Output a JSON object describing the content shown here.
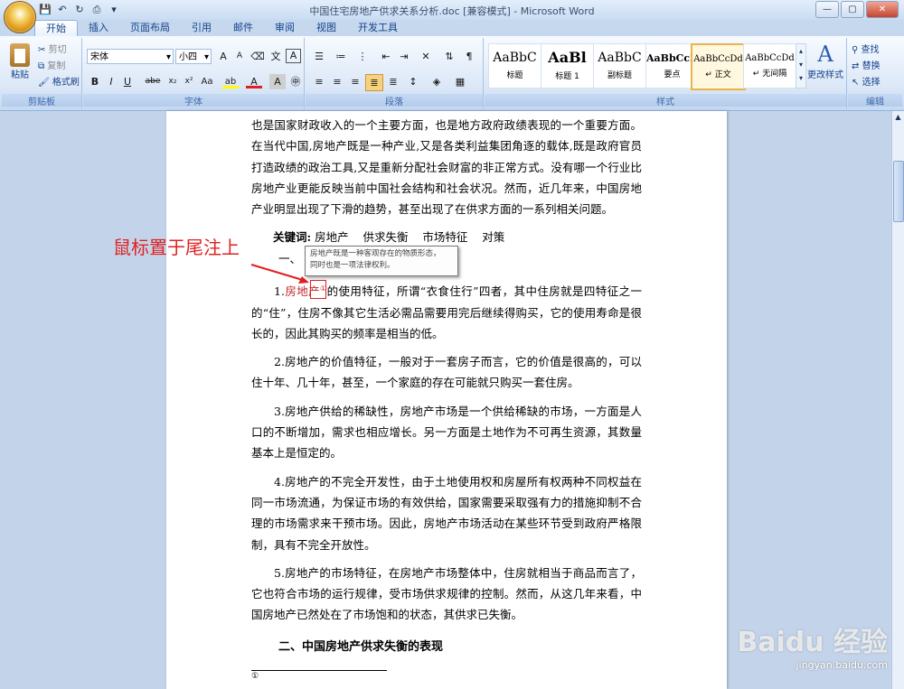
{
  "window": {
    "title": "中国住宅房地产供求关系分析.doc [兼容模式] - Microsoft Word",
    "min": "—",
    "max": "▢",
    "close": "✕"
  },
  "tabs": [
    "开始",
    "插入",
    "页面布局",
    "引用",
    "邮件",
    "审阅",
    "视图",
    "开发工具"
  ],
  "clipboard": {
    "paste": "粘贴",
    "cut": "剪切",
    "copy": "复制",
    "format_painter": "格式刷",
    "label": "剪贴板"
  },
  "font": {
    "name": "宋体",
    "size": "小四",
    "label": "字体",
    "bold": "B",
    "italic": "I",
    "underline": "U",
    "strike": "abe",
    "sub": "x₂",
    "sup": "x²",
    "case": "Aa",
    "grow": "A",
    "shrink": "A",
    "highlight": "ab",
    "color": "A",
    "char_border": "A"
  },
  "paragraph": {
    "label": "段落"
  },
  "styles": {
    "label": "样式",
    "items": [
      {
        "sample": "AaBbC",
        "name": "标题"
      },
      {
        "sample": "AaBl",
        "name": "标题 1"
      },
      {
        "sample": "AaBbC",
        "name": "副标题"
      },
      {
        "sample": "AaBbCcD",
        "name": "要点"
      },
      {
        "sample": "AaBbCcDd",
        "name": "↵ 正文"
      },
      {
        "sample": "AaBbCcDd",
        "name": "↵ 无间隔"
      }
    ],
    "change": "更改样式"
  },
  "editing": {
    "find": "查找",
    "replace": "替换",
    "select": "选择",
    "label": "编辑"
  },
  "document": {
    "para1": "也是国家财政收入的一个主要方面，也是地方政府政绩表现的一个重要方面。在当代中国,房地产既是一种产业,又是各类利益集团角逐的载体,既是政府官员打造政绩的政治工具,又是重新分配社会财富的非正常方式。没有哪一个行业比房地产业更能反映当前中国社会结构和社会状况。然而，近几年来，中国房地产业明显出现了下滑的趋势，甚至出现了在供求方面的一系列相关问题。",
    "keywords_label": "关键词:",
    "keywords": "房地产    供求失衡    市场特征    对策",
    "section1": "一、",
    "p1_prefix": "1.",
    "p1_term": "房地产",
    "p1_mark": "①",
    "p1_rest": "的使用特征，所谓“衣食住行”四者，其中住房就是四特征之一的“住”，住房不像其它生活必需品需要用完后继续得购买，它的使用寿命是很长的，因此其购买的频率是相当的低。",
    "p2": "2.房地产的价值特征，一般对于一套房子而言，它的价值是很高的，可以住十年、几十年，甚至，一个家庭的存在可能就只购买一套住房。",
    "p3": "3.房地产供给的稀缺性，房地产市场是一个供给稀缺的市场，一方面是人口的不断增加，需求也相应增长。另一方面是土地作为不可再生资源，其数量基本上是恒定的。",
    "p4": "4.房地产的不完全开发性，由于土地使用权和房屋所有权两种不同权益在同一市场流通，为保证市场的有效供给，国家需要采取强有力的措施抑制不合理的市场需求来干预市场。因此，房地产市场活动在某些环节受到政府严格限制，具有不完全开放性。",
    "p5": "5.房地产的市场特征，在房地产市场整体中，住房就相当于商品而言了，它也符合市场的运行规律，受市场供求规律的控制。然而，从这几年来看，中国房地产已然处在了市场饱和的状态，其供求已失衡。",
    "section2": "二、中国房地产供求失衡的表现",
    "footnote_mark": "①"
  },
  "tooltip": {
    "line1": "房地产既是一种客观存在的物质形态，",
    "line2": "同时也是一项法律权利。"
  },
  "annotation": "鼠标置于尾注上",
  "watermark": {
    "brand": "Baidu 经验",
    "url": "jingyan.baidu.com"
  }
}
